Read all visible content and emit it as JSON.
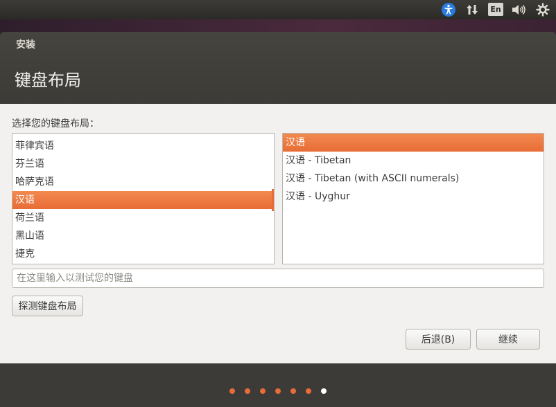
{
  "top_panel": {
    "icons": [
      "accessibility-icon",
      "network-transfer-icon",
      "keyboard-indicator",
      "volume-icon",
      "settings-gear-icon"
    ],
    "keyboard_indicator": "En",
    "accessibility_color": "#2a7bde"
  },
  "window": {
    "title": "安装",
    "page_title": "键盘布局"
  },
  "content": {
    "prompt": "选择您的键盘布局：",
    "layouts": [
      {
        "label": "菲律宾语",
        "selected": false
      },
      {
        "label": "芬兰语",
        "selected": false
      },
      {
        "label": "哈萨克语",
        "selected": false
      },
      {
        "label": "汉语",
        "selected": true
      },
      {
        "label": "荷兰语",
        "selected": false
      },
      {
        "label": "黑山语",
        "selected": false
      },
      {
        "label": "捷克",
        "selected": false
      }
    ],
    "variants": [
      {
        "label": "汉语",
        "selected": true
      },
      {
        "label": "汉语 - Tibetan",
        "selected": false
      },
      {
        "label": "汉语 - Tibetan (with ASCII numerals)",
        "selected": false
      },
      {
        "label": "汉语 - Uyghur",
        "selected": false
      }
    ],
    "test_input_placeholder": "在这里输入以测试您的键盘",
    "detect_button": "探测键盘布局",
    "back_button": "后退(B)",
    "continue_button": "继续"
  },
  "progress": {
    "total_steps": 7,
    "current_step": 7,
    "done_color": "#e86c36",
    "current_color": "#ffffff"
  },
  "colors": {
    "accent": "#e86c36",
    "panel": "#3c3b37",
    "content_bg": "#f2f1f0"
  }
}
